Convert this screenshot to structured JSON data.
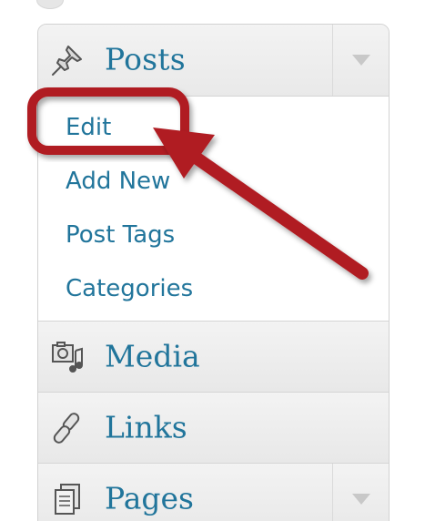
{
  "menu": {
    "posts": {
      "label": "Posts",
      "icon": "pushpin-icon",
      "submenu": [
        "Edit",
        "Add New",
        "Post Tags",
        "Categories"
      ]
    },
    "media": {
      "label": "Media",
      "icon": "media-icon"
    },
    "links": {
      "label": "Links",
      "icon": "chain-link-icon"
    },
    "pages": {
      "label": "Pages",
      "icon": "pages-icon"
    }
  },
  "colors": {
    "link": "#21759b",
    "annotation": "#b01c22",
    "menu_bg": "#efefef",
    "submenu_bg": "#ffffff"
  },
  "annotation": {
    "highlight_target": "Edit",
    "type": "rounded-box-with-arrow"
  }
}
